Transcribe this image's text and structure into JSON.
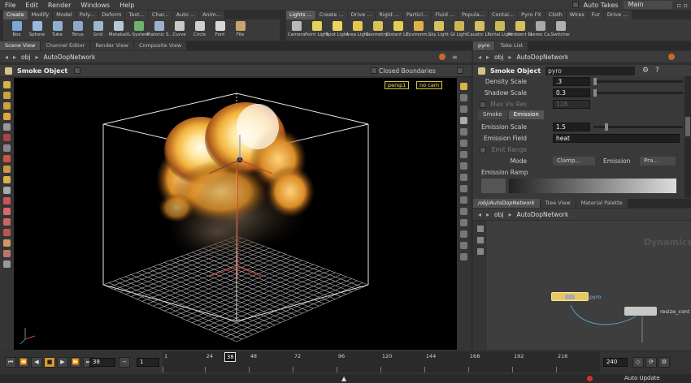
{
  "menu": [
    "File",
    "Edit",
    "Render",
    "Windows",
    "Help"
  ],
  "top_right": {
    "auto_takes": "Auto Takes",
    "desktop": "Main"
  },
  "shelf_left": {
    "tabs": [
      "Create",
      "Modify",
      "Model",
      "Poly...",
      "Deform",
      "Text...",
      "Char...",
      "Auto ...",
      "Anim..."
    ],
    "tools": [
      {
        "label": "Box",
        "color": "#7aa7d8"
      },
      {
        "label": "Sphere",
        "color": "#9ab8dd"
      },
      {
        "label": "Tube",
        "color": "#8fb0cf"
      },
      {
        "label": "Torus",
        "color": "#8fa8c8"
      },
      {
        "label": "Grid",
        "color": "#9fb6c8"
      },
      {
        "label": "Metaball",
        "color": "#b7c7d7"
      },
      {
        "label": "L-System",
        "color": "#6db36d"
      },
      {
        "label": "Platonic S...",
        "color": "#9db1c9"
      },
      {
        "label": "Curve",
        "color": "#c9c9c9"
      },
      {
        "label": "Circle",
        "color": "#cfcfcf"
      },
      {
        "label": "Font",
        "color": "#d9d9d9"
      },
      {
        "label": "File",
        "color": "#c8a56a"
      }
    ]
  },
  "shelf_right": {
    "tabs": [
      "Lights ...",
      "Create ...",
      "Drive ...",
      "Rigid ...",
      "Particl...",
      "Fluid ...",
      "Popula...",
      "Contai...",
      "Pyro FX",
      "Cloth",
      "Wires",
      "Fur",
      "Drive ..."
    ],
    "tools": [
      {
        "label": "Camera",
        "color": "#b9b9b9"
      },
      {
        "label": "Point Light",
        "color": "#e3d05a"
      },
      {
        "label": "Spot Light",
        "color": "#e8d55e"
      },
      {
        "label": "Area Light",
        "color": "#e4c650"
      },
      {
        "label": "Geometry...",
        "color": "#d7c25b"
      },
      {
        "label": "Distant Li...",
        "color": "#e2cf52"
      },
      {
        "label": "Environm...",
        "color": "#dfb342"
      },
      {
        "label": "Sky Light",
        "color": "#d5c15e"
      },
      {
        "label": "GI Light",
        "color": "#cbb755"
      },
      {
        "label": "Caustic Li...",
        "color": "#d3c060"
      },
      {
        "label": "Portal Light",
        "color": "#ccba56"
      },
      {
        "label": "Ambient Li...",
        "color": "#d5c15e"
      },
      {
        "label": "Stereo Ca...",
        "color": "#a9a9a9"
      },
      {
        "label": "Switcher",
        "color": "#b0b0b0"
      }
    ]
  },
  "left_pane": {
    "tabs": [
      "Scene View",
      "Channel Editor",
      "Render View",
      "Composite View"
    ],
    "path": {
      "context": "obj",
      "node": "AutoDopNetwork"
    },
    "object_title": "Smoke Object",
    "closed_boundaries": "Closed Boundaries",
    "camera_menu": "persp1",
    "cam_menu": "no cam"
  },
  "right_pane": {
    "tabs": [
      "pyro",
      "Take List"
    ],
    "path": {
      "context": "obj",
      "node": "AutoDopNetwork"
    },
    "object_type": "Smoke Object",
    "object_name": "pyro",
    "params": {
      "density_scale_label": "Density Scale",
      "density_scale": ".3",
      "shadow_scale_label": "Shadow Scale",
      "shadow_scale": "0.3",
      "max_vis_res_label": "Max Vis Res",
      "max_vis_res": "128",
      "subtabs": [
        "Smoke",
        "Emission"
      ],
      "emission_scale_label": "Emission Scale",
      "emission_scale": "1.5",
      "emission_field_label": "Emission Field",
      "emission_field": "heat",
      "emit_range_label": "Emit Range",
      "mode_label": "Mode",
      "mode_value": "Clamp...",
      "emission_label": "Emission",
      "emission_value": "Pra...",
      "emission_ramp_label": "Emission Ramp"
    }
  },
  "network_pane": {
    "tabs": [
      "/obj/AutoDopNetwork",
      "Tree View",
      "Material Palette"
    ],
    "path": {
      "context": "obj",
      "node": "AutoDopNetwork"
    },
    "watermark": "Dynamics",
    "nodes": {
      "pyro": "pyro",
      "resize": "resize_cont"
    }
  },
  "timeline": {
    "current_frame": "38",
    "step": "1",
    "end_frame": "240",
    "ticks": [
      "1",
      "24",
      "48",
      "72",
      "96",
      "120",
      "144",
      "168",
      "192",
      "216"
    ],
    "auto_update": "Auto Update"
  },
  "colors": {
    "accent_orange": "#d79a2a",
    "node_pyro": "#e8c860",
    "viewport_bg": "#000000"
  }
}
